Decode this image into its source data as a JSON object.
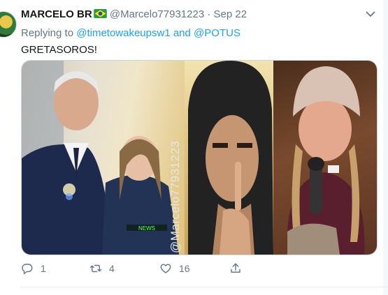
{
  "tweet": {
    "author_name": "MARCELO BR",
    "handle": "@Marcelo77931223",
    "separator": "·",
    "date": "Sep 22",
    "replying_prefix": "Replying to ",
    "reply_user_1": "@timetowakeupsw1",
    "reply_join": " and ",
    "reply_user_2": "@POTUS",
    "body": "GRETASOROS!",
    "media_watermark": "@Marcelo77931223",
    "media_badge": "NEWS"
  },
  "actions": {
    "replies": "1",
    "retweets": "4",
    "likes": "16"
  },
  "colors": {
    "link": "#1da1f2",
    "muted": "#657786",
    "text": "#14171a"
  },
  "icons": [
    "brazil-flag-icon",
    "chevron-down-icon",
    "reply-icon",
    "retweet-icon",
    "like-icon",
    "share-icon"
  ]
}
